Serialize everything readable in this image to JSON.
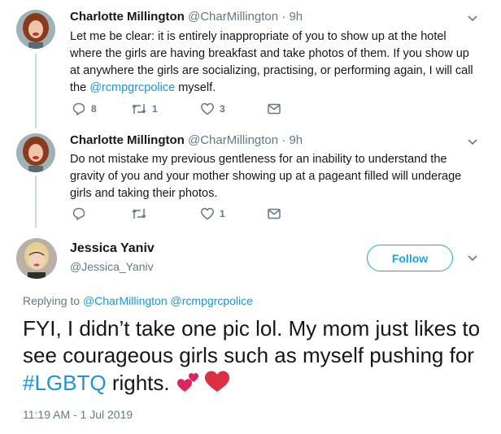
{
  "tweets": [
    {
      "name": "Charlotte Millington",
      "handle": "@CharMillington",
      "separator": "·",
      "time": "9h",
      "text_before": "Let me be clear: it is entirely inappropriate of you to show up at the hotel where the girls are having breakfast and take photos of them. If you show up at anywhere the girls are socializing, practising, or performing again, I will call the ",
      "mention": "@rcmpgrcpolice",
      "text_after": " myself.",
      "replies": "8",
      "retweets": "1",
      "likes": "3"
    },
    {
      "name": "Charlotte Millington",
      "handle": "@CharMillington",
      "separator": "·",
      "time": "9h",
      "text": "Do not mistake my previous gentleness for an inability to understand the gravity of you and your mother showing up at a pageant filled will underage girls and taking their photos.",
      "replies": "",
      "retweets": "",
      "likes": "1"
    }
  ],
  "main_tweet": {
    "name": "Jessica Yaniv",
    "handle": "@Jessica_Yaniv",
    "follow_label": "Follow",
    "replying_prefix": "Replying to ",
    "replying_to_1": "@CharMillington",
    "replying_to_2": "@rcmpgrcpolice",
    "text_before": "FYI, I didn’t take one pic lol. My mom just likes to see courageous girls such as myself pushing for ",
    "hashtag": "#LGBTQ",
    "text_after": " rights. ",
    "timestamp": "11:19 AM - 1 Jul 2019"
  },
  "colors": {
    "link": "#1b95e0",
    "follow": "#1da1f2",
    "muted": "#657786",
    "heart": "#e0245e"
  },
  "icons": [
    "reply-icon",
    "retweet-icon",
    "like-icon",
    "direct-message-icon",
    "chevron-down-icon",
    "two-hearts-emoji",
    "red-heart-emoji"
  ]
}
